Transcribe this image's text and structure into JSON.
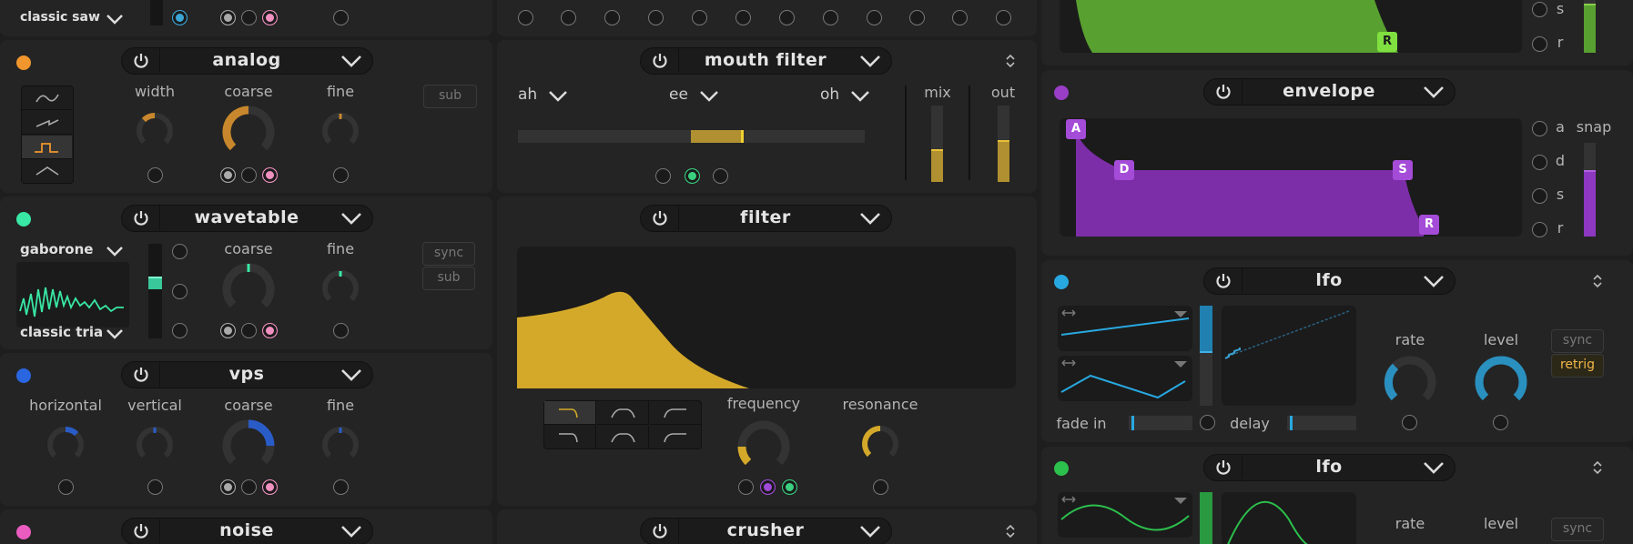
{
  "osc1": {
    "sub_name": "classic saw",
    "color": "#e8447a"
  },
  "osc_analog": {
    "name": "analog",
    "color": "#f0962c",
    "labels": [
      "width",
      "coarse",
      "fine"
    ],
    "sub": "sub"
  },
  "osc_wavetable": {
    "name": "wavetable",
    "color": "#38e8a4",
    "wavetable": "gaborone",
    "sub_name": "classic tria",
    "labels": [
      "coarse",
      "fine"
    ],
    "sync": "sync",
    "sub": "sub"
  },
  "osc_vps": {
    "name": "vps",
    "color": "#2a66e0",
    "labels": [
      "horizontal",
      "vertical",
      "coarse",
      "fine"
    ]
  },
  "osc_noise": {
    "name": "noise",
    "color": "#ea5cc0"
  },
  "mouth_filter": {
    "name": "mouth filter",
    "vowels": [
      "ah",
      "ee",
      "oh"
    ],
    "mix": "mix",
    "out": "out",
    "color": "#c8a030"
  },
  "filter": {
    "name": "filter",
    "labels": [
      "frequency",
      "resonance"
    ],
    "color": "#d4a92a"
  },
  "crusher": {
    "name": "crusher"
  },
  "amp_env": {
    "labels": [
      "s",
      "r"
    ],
    "release_marker": "R",
    "color": "#58a030"
  },
  "envelope": {
    "name": "envelope",
    "color": "#9a3ec8",
    "markers": [
      "A",
      "D",
      "S",
      "R"
    ],
    "labels": [
      "a",
      "d",
      "s",
      "r"
    ],
    "snap": "snap"
  },
  "lfo1": {
    "name": "lfo",
    "color": "#28a8e0",
    "labels": [
      "fade in",
      "delay",
      "rate",
      "level"
    ],
    "sync": "sync",
    "retrig": "retrig"
  },
  "lfo2": {
    "name": "lfo",
    "color": "#2cc04c",
    "labels": [
      "rate",
      "level"
    ],
    "sync": "sync"
  }
}
